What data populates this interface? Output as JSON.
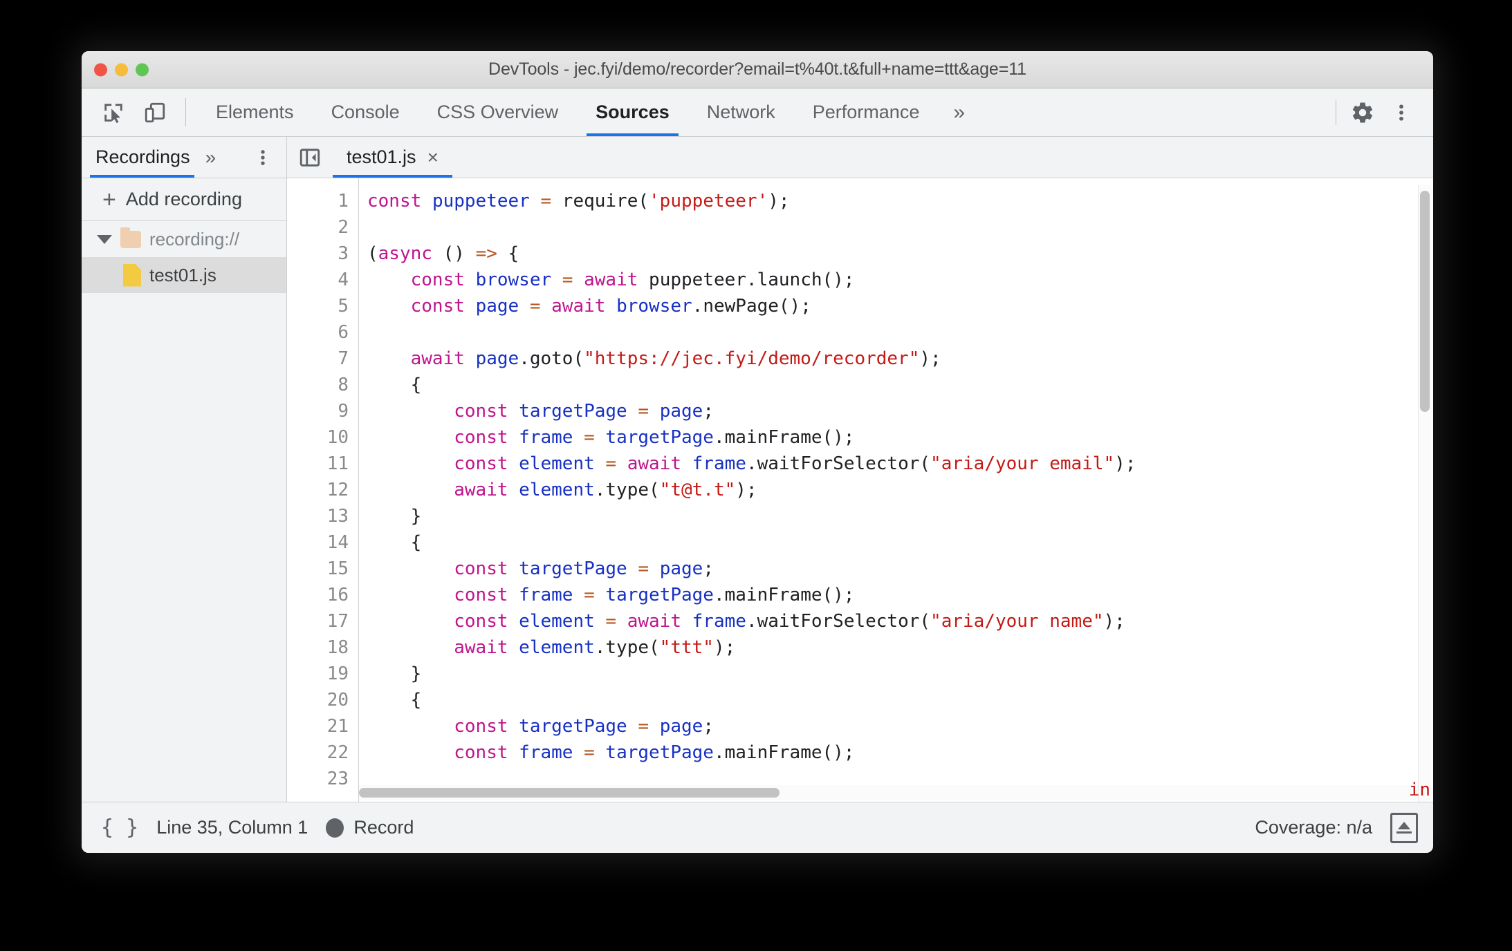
{
  "window": {
    "title": "DevTools - jec.fyi/demo/recorder?email=t%40t.t&full+name=ttt&age=11"
  },
  "toolbar": {
    "inspect_icon": "inspect-element-icon",
    "device_icon": "device-toolbar-icon",
    "tabs": [
      {
        "label": "Elements",
        "active": false
      },
      {
        "label": "Console",
        "active": false
      },
      {
        "label": "CSS Overview",
        "active": false
      },
      {
        "label": "Sources",
        "active": true
      },
      {
        "label": "Network",
        "active": false
      },
      {
        "label": "Performance",
        "active": false
      }
    ],
    "more_tabs": "»",
    "settings_icon": "gear-icon",
    "menu_icon": "kebab-menu-icon",
    "accent_color": "#1a73e8"
  },
  "sidebar": {
    "tab_label": "Recordings",
    "more_chevron": "»",
    "kebab": "kebab-menu-icon",
    "add_recording": "Add recording",
    "add_icon": "+",
    "tree": [
      {
        "label": "recording://",
        "type": "folder",
        "expanded": true,
        "selected": false
      },
      {
        "label": "test01.js",
        "type": "file",
        "expanded": false,
        "selected": true
      }
    ]
  },
  "editor": {
    "panel_toggle_icon": "collapse-sidebar-icon",
    "tab_label": "test01.js",
    "close_icon": "×",
    "line_numbers": [
      "1",
      "2",
      "3",
      "4",
      "5",
      "6",
      "7",
      "8",
      "9",
      "10",
      "11",
      "12",
      "13",
      "14",
      "15",
      "16",
      "17",
      "18",
      "19",
      "20",
      "21",
      "22",
      "23"
    ],
    "clipped_right_text": "in",
    "code_lines": [
      {
        "n": 1,
        "tokens": [
          {
            "t": "const",
            "c": "kw"
          },
          {
            "t": " ",
            "c": "pl"
          },
          {
            "t": "puppeteer",
            "c": "id"
          },
          {
            "t": " ",
            "c": "pl"
          },
          {
            "t": "=",
            "c": "op"
          },
          {
            "t": " require(",
            "c": "pl"
          },
          {
            "t": "'puppeteer'",
            "c": "str"
          },
          {
            "t": ");",
            "c": "pl"
          }
        ]
      },
      {
        "n": 2,
        "tokens": []
      },
      {
        "n": 3,
        "tokens": [
          {
            "t": "(",
            "c": "pl"
          },
          {
            "t": "async",
            "c": "kw"
          },
          {
            "t": " () ",
            "c": "pl"
          },
          {
            "t": "=>",
            "c": "op"
          },
          {
            "t": " {",
            "c": "pl"
          }
        ]
      },
      {
        "n": 4,
        "tokens": [
          {
            "t": "    ",
            "c": "pl"
          },
          {
            "t": "const",
            "c": "kw"
          },
          {
            "t": " ",
            "c": "pl"
          },
          {
            "t": "browser",
            "c": "id"
          },
          {
            "t": " ",
            "c": "pl"
          },
          {
            "t": "=",
            "c": "op"
          },
          {
            "t": " ",
            "c": "pl"
          },
          {
            "t": "await",
            "c": "kw"
          },
          {
            "t": " puppeteer.launch();",
            "c": "pl"
          }
        ]
      },
      {
        "n": 5,
        "tokens": [
          {
            "t": "    ",
            "c": "pl"
          },
          {
            "t": "const",
            "c": "kw"
          },
          {
            "t": " ",
            "c": "pl"
          },
          {
            "t": "page",
            "c": "id"
          },
          {
            "t": " ",
            "c": "pl"
          },
          {
            "t": "=",
            "c": "op"
          },
          {
            "t": " ",
            "c": "pl"
          },
          {
            "t": "await",
            "c": "kw"
          },
          {
            "t": " ",
            "c": "pl"
          },
          {
            "t": "browser",
            "c": "id"
          },
          {
            "t": ".newPage();",
            "c": "pl"
          }
        ]
      },
      {
        "n": 6,
        "tokens": []
      },
      {
        "n": 7,
        "tokens": [
          {
            "t": "    ",
            "c": "pl"
          },
          {
            "t": "await",
            "c": "kw"
          },
          {
            "t": " ",
            "c": "pl"
          },
          {
            "t": "page",
            "c": "id"
          },
          {
            "t": ".goto(",
            "c": "pl"
          },
          {
            "t": "\"https://jec.fyi/demo/recorder\"",
            "c": "str"
          },
          {
            "t": ");",
            "c": "pl"
          }
        ]
      },
      {
        "n": 8,
        "tokens": [
          {
            "t": "    {",
            "c": "pl"
          }
        ]
      },
      {
        "n": 9,
        "tokens": [
          {
            "t": "        ",
            "c": "pl"
          },
          {
            "t": "const",
            "c": "kw"
          },
          {
            "t": " ",
            "c": "pl"
          },
          {
            "t": "targetPage",
            "c": "id"
          },
          {
            "t": " ",
            "c": "pl"
          },
          {
            "t": "=",
            "c": "op"
          },
          {
            "t": " ",
            "c": "pl"
          },
          {
            "t": "page",
            "c": "id"
          },
          {
            "t": ";",
            "c": "pl"
          }
        ]
      },
      {
        "n": 10,
        "tokens": [
          {
            "t": "        ",
            "c": "pl"
          },
          {
            "t": "const",
            "c": "kw"
          },
          {
            "t": " ",
            "c": "pl"
          },
          {
            "t": "frame",
            "c": "id"
          },
          {
            "t": " ",
            "c": "pl"
          },
          {
            "t": "=",
            "c": "op"
          },
          {
            "t": " ",
            "c": "pl"
          },
          {
            "t": "targetPage",
            "c": "id"
          },
          {
            "t": ".mainFrame();",
            "c": "pl"
          }
        ]
      },
      {
        "n": 11,
        "tokens": [
          {
            "t": "        ",
            "c": "pl"
          },
          {
            "t": "const",
            "c": "kw"
          },
          {
            "t": " ",
            "c": "pl"
          },
          {
            "t": "element",
            "c": "id"
          },
          {
            "t": " ",
            "c": "pl"
          },
          {
            "t": "=",
            "c": "op"
          },
          {
            "t": " ",
            "c": "pl"
          },
          {
            "t": "await",
            "c": "kw"
          },
          {
            "t": " ",
            "c": "pl"
          },
          {
            "t": "frame",
            "c": "id"
          },
          {
            "t": ".waitForSelector(",
            "c": "pl"
          },
          {
            "t": "\"aria/your email\"",
            "c": "str"
          },
          {
            "t": ");",
            "c": "pl"
          }
        ]
      },
      {
        "n": 12,
        "tokens": [
          {
            "t": "        ",
            "c": "pl"
          },
          {
            "t": "await",
            "c": "kw"
          },
          {
            "t": " ",
            "c": "pl"
          },
          {
            "t": "element",
            "c": "id"
          },
          {
            "t": ".type(",
            "c": "pl"
          },
          {
            "t": "\"t@t.t\"",
            "c": "str"
          },
          {
            "t": ");",
            "c": "pl"
          }
        ]
      },
      {
        "n": 13,
        "tokens": [
          {
            "t": "    }",
            "c": "pl"
          }
        ]
      },
      {
        "n": 14,
        "tokens": [
          {
            "t": "    {",
            "c": "pl"
          }
        ]
      },
      {
        "n": 15,
        "tokens": [
          {
            "t": "        ",
            "c": "pl"
          },
          {
            "t": "const",
            "c": "kw"
          },
          {
            "t": " ",
            "c": "pl"
          },
          {
            "t": "targetPage",
            "c": "id"
          },
          {
            "t": " ",
            "c": "pl"
          },
          {
            "t": "=",
            "c": "op"
          },
          {
            "t": " ",
            "c": "pl"
          },
          {
            "t": "page",
            "c": "id"
          },
          {
            "t": ";",
            "c": "pl"
          }
        ]
      },
      {
        "n": 16,
        "tokens": [
          {
            "t": "        ",
            "c": "pl"
          },
          {
            "t": "const",
            "c": "kw"
          },
          {
            "t": " ",
            "c": "pl"
          },
          {
            "t": "frame",
            "c": "id"
          },
          {
            "t": " ",
            "c": "pl"
          },
          {
            "t": "=",
            "c": "op"
          },
          {
            "t": " ",
            "c": "pl"
          },
          {
            "t": "targetPage",
            "c": "id"
          },
          {
            "t": ".mainFrame();",
            "c": "pl"
          }
        ]
      },
      {
        "n": 17,
        "tokens": [
          {
            "t": "        ",
            "c": "pl"
          },
          {
            "t": "const",
            "c": "kw"
          },
          {
            "t": " ",
            "c": "pl"
          },
          {
            "t": "element",
            "c": "id"
          },
          {
            "t": " ",
            "c": "pl"
          },
          {
            "t": "=",
            "c": "op"
          },
          {
            "t": " ",
            "c": "pl"
          },
          {
            "t": "await",
            "c": "kw"
          },
          {
            "t": " ",
            "c": "pl"
          },
          {
            "t": "frame",
            "c": "id"
          },
          {
            "t": ".waitForSelector(",
            "c": "pl"
          },
          {
            "t": "\"aria/your name\"",
            "c": "str"
          },
          {
            "t": ");",
            "c": "pl"
          }
        ]
      },
      {
        "n": 18,
        "tokens": [
          {
            "t": "        ",
            "c": "pl"
          },
          {
            "t": "await",
            "c": "kw"
          },
          {
            "t": " ",
            "c": "pl"
          },
          {
            "t": "element",
            "c": "id"
          },
          {
            "t": ".type(",
            "c": "pl"
          },
          {
            "t": "\"ttt\"",
            "c": "str"
          },
          {
            "t": ");",
            "c": "pl"
          }
        ]
      },
      {
        "n": 19,
        "tokens": [
          {
            "t": "    }",
            "c": "pl"
          }
        ]
      },
      {
        "n": 20,
        "tokens": [
          {
            "t": "    {",
            "c": "pl"
          }
        ]
      },
      {
        "n": 21,
        "tokens": [
          {
            "t": "        ",
            "c": "pl"
          },
          {
            "t": "const",
            "c": "kw"
          },
          {
            "t": " ",
            "c": "pl"
          },
          {
            "t": "targetPage",
            "c": "id"
          },
          {
            "t": " ",
            "c": "pl"
          },
          {
            "t": "=",
            "c": "op"
          },
          {
            "t": " ",
            "c": "pl"
          },
          {
            "t": "page",
            "c": "id"
          },
          {
            "t": ";",
            "c": "pl"
          }
        ]
      },
      {
        "n": 22,
        "tokens": [
          {
            "t": "        ",
            "c": "pl"
          },
          {
            "t": "const",
            "c": "kw"
          },
          {
            "t": " ",
            "c": "pl"
          },
          {
            "t": "frame",
            "c": "id"
          },
          {
            "t": " ",
            "c": "pl"
          },
          {
            "t": "=",
            "c": "op"
          },
          {
            "t": " ",
            "c": "pl"
          },
          {
            "t": "targetPage",
            "c": "id"
          },
          {
            "t": ".mainFrame();",
            "c": "pl"
          }
        ]
      }
    ]
  },
  "statusbar": {
    "format_icon": "{ }",
    "cursor_position": "Line 35, Column 1",
    "record_label": "Record",
    "record_icon": "record-dot-icon",
    "coverage": "Coverage: n/a",
    "drawer_icon": "show-drawer-icon"
  }
}
